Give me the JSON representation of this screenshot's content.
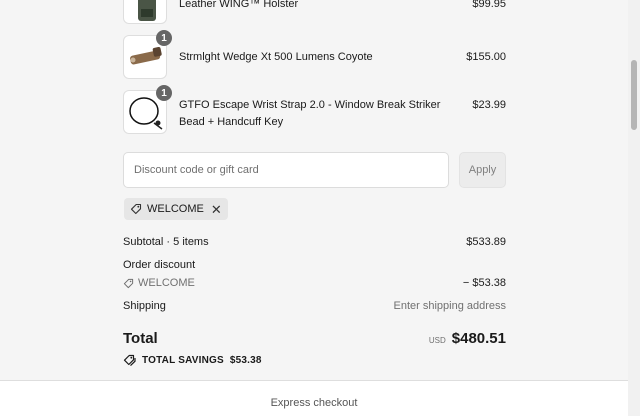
{
  "line_items": [
    {
      "name": "Leather WING™ Holster",
      "price": "$99.95",
      "quantity": ""
    },
    {
      "name": "Strmlght Wedge Xt 500 Lumens Coyote",
      "price": "$155.00",
      "quantity": "1"
    },
    {
      "name": "GTFO Escape Wrist Strap 2.0 - Window Break Striker Bead + Handcuff Key",
      "price": "$23.99",
      "quantity": "1"
    }
  ],
  "discount": {
    "placeholder": "Discount code or gift card",
    "apply_label": "Apply",
    "applied_code": "WELCOME"
  },
  "summary": {
    "subtotal_label": "Subtotal · 5 items",
    "subtotal_value": "$533.89",
    "order_discount_label": "Order discount",
    "discount_code": "WELCOME",
    "discount_value": "− $53.38",
    "shipping_label": "Shipping",
    "shipping_value": "Enter shipping address",
    "total_label": "Total",
    "currency": "USD",
    "total_value": "$480.51",
    "savings_label": "TOTAL SAVINGS",
    "savings_value": "$53.38"
  },
  "express_checkout_label": "Express checkout",
  "colors": {
    "background": "#f5f5f5",
    "badge": "#666666",
    "chip": "#e6e6e6"
  }
}
